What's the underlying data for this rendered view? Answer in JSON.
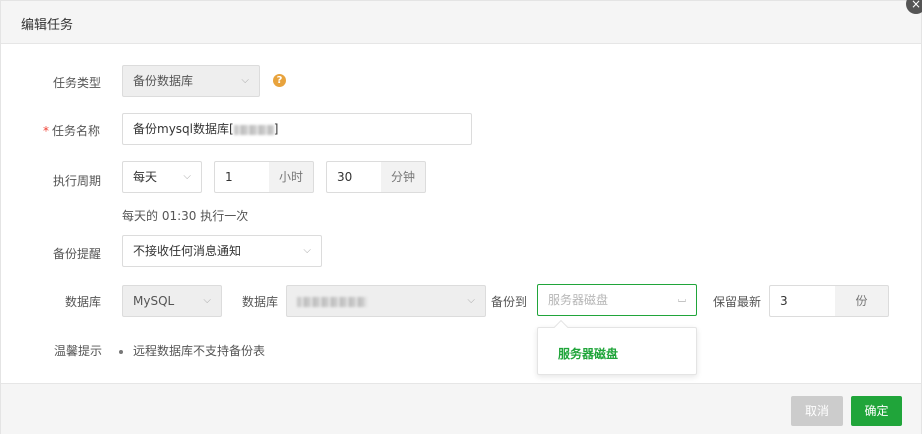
{
  "dialog": {
    "title": "编辑任务",
    "close_glyph": "×"
  },
  "form": {
    "task_type": {
      "label": "任务类型",
      "value": "备份数据库",
      "help_glyph": "?"
    },
    "task_name": {
      "required_mark": "*",
      "label": "任务名称",
      "value_prefix": "备份mysql数据库[",
      "value_suffix": "]"
    },
    "cycle": {
      "label": "执行周期",
      "period": "每天",
      "hour_value": "1",
      "hour_unit": "小时",
      "minute_value": "30",
      "minute_unit": "分钟",
      "hint": "每天的 01:30 执行一次"
    },
    "reminder": {
      "label": "备份提醒",
      "value": "不接收任何消息通知"
    },
    "database": {
      "label": "数据库",
      "db_type": "MySQL",
      "db_label": "数据库",
      "backup_to_label": "备份到",
      "backup_to_placeholder": "服务器磁盘",
      "keep_label": "保留最新",
      "keep_value": "3",
      "keep_unit": "份"
    },
    "dropdown": {
      "options": [
        "服务器磁盘"
      ]
    },
    "tips": {
      "label": "温馨提示",
      "items": [
        "远程数据库不支持备份表"
      ]
    }
  },
  "footer": {
    "cancel_label": "取消",
    "ok_label": "确定"
  },
  "colors": {
    "accent": "#20a53a",
    "help": "#e8a33d",
    "required": "#f04134"
  }
}
